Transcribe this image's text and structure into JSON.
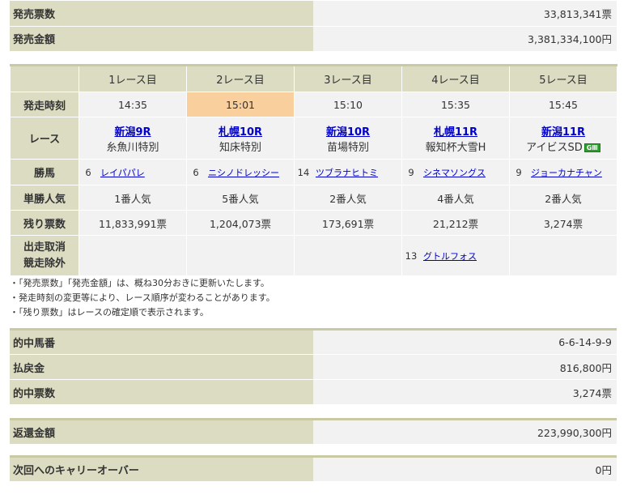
{
  "sales": [
    {
      "label": "発売票数",
      "value": "33,813,341票"
    },
    {
      "label": "発売金額",
      "value": "3,381,334,100円"
    }
  ],
  "races": {
    "headers": [
      "1レース目",
      "2レース目",
      "3レース目",
      "4レース目",
      "5レース目"
    ],
    "row_labels": {
      "start_time": "発走時刻",
      "race": "レース",
      "winner": "勝馬",
      "popularity": "単勝人気",
      "remaining": "残り票数",
      "scratch": "出走取消\n競走除外"
    },
    "start_times": [
      "14:35",
      "15:01",
      "15:10",
      "15:35",
      "15:45"
    ],
    "race_links": [
      "新潟9R",
      "札幌10R",
      "新潟10R",
      "札幌11R",
      "新潟11R"
    ],
    "race_names": [
      "糸魚川特別",
      "知床特別",
      "苗場特別",
      "報知杯大雪H",
      "アイビスSD"
    ],
    "grade_badge": "GⅢ",
    "winner_numbers": [
      "6",
      "6",
      "14",
      "9",
      "9"
    ],
    "winner_names": [
      "レイパパレ",
      "ニシノドレッシー",
      "ツブラナヒトミ",
      "シネマソングス",
      "ジョーカナチャン"
    ],
    "popularity": [
      "1番人気",
      "5番人気",
      "2番人気",
      "4番人気",
      "2番人気"
    ],
    "remaining": [
      "11,833,991票",
      "1,204,073票",
      "173,691票",
      "21,212票",
      "3,274票"
    ],
    "scratch_number": "13",
    "scratch_name": "グトルフォス"
  },
  "notes": [
    "・「発売票数」「発売金額」は、概ね30分おきに更新いたします。",
    "・発走時刻の変更等により、レース順序が変わることがあります。",
    "・「残り票数」はレースの確定順で表示されます。"
  ],
  "results": [
    {
      "label": "的中馬番",
      "value": "6-6-14-9-9"
    },
    {
      "label": "払戻金",
      "value": "816,800円"
    },
    {
      "label": "的中票数",
      "value": "3,274票"
    }
  ],
  "refund": {
    "label": "返還金額",
    "value": "223,990,300円"
  },
  "carryover": {
    "label": "次回へのキャリーオーバー",
    "value": "0円"
  },
  "colors": {
    "header_bg": "#dcdcc2",
    "cell_bg": "#f2f2f2",
    "highlight": "#f9cf9e",
    "link": "#0000cc",
    "grade_badge": "#2e9d2e"
  }
}
